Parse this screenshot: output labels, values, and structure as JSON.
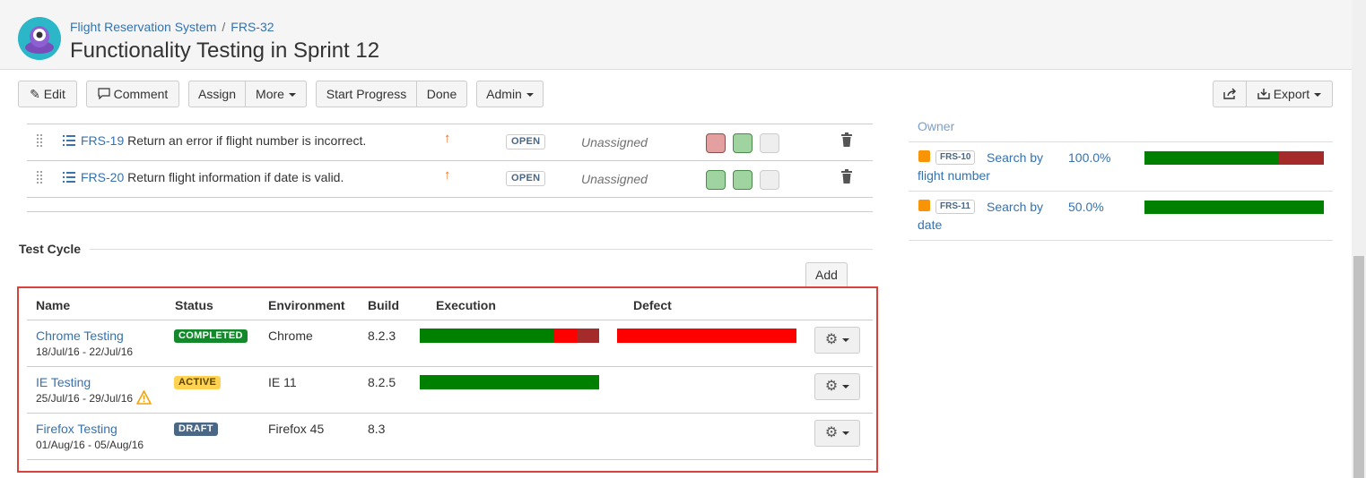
{
  "breadcrumb": {
    "project": "Flight Reservation System",
    "separator": "/",
    "issue_key": "FRS-32"
  },
  "page": {
    "title": "Functionality Testing in Sprint 12"
  },
  "toolbar": {
    "edit": "Edit",
    "comment": "Comment",
    "assign": "Assign",
    "more": "More",
    "start_progress": "Start Progress",
    "done": "Done",
    "admin": "Admin",
    "export": "Export"
  },
  "issues": [
    {
      "key": "FRS-19",
      "summary": "Return an error if flight number is incorrect.",
      "status": "OPEN",
      "assignee": "Unassigned",
      "results": [
        "red",
        "green",
        "grey"
      ]
    },
    {
      "key": "FRS-20",
      "summary": "Return flight information if date is valid.",
      "status": "OPEN",
      "assignee": "Unassigned",
      "results": [
        "green",
        "green",
        "grey"
      ]
    }
  ],
  "test_cycle": {
    "section_title": "Test Cycle",
    "add_label": "Add",
    "columns": {
      "name": "Name",
      "status": "Status",
      "environment": "Environment",
      "build": "Build",
      "execution": "Execution",
      "defect": "Defect"
    },
    "rows": [
      {
        "name": "Chrome Testing",
        "dates": "18/Jul/16 - 22/Jul/16",
        "status": "COMPLETED",
        "status_color": "#14892c",
        "environment": "Chrome",
        "build": "8.2.3",
        "execution": [
          {
            "fraction": 0.75,
            "color": "#008000"
          },
          {
            "fraction": 0.125,
            "color": "#ff0000"
          },
          {
            "fraction": 0.125,
            "color": "#a52a2a"
          }
        ],
        "defect": [
          {
            "fraction": 1.0,
            "color": "#ff0000"
          }
        ],
        "warning": false
      },
      {
        "name": "IE Testing",
        "dates": "25/Jul/16 - 29/Jul/16",
        "status": "ACTIVE",
        "status_color": "#ffd351",
        "environment": "IE 11",
        "build": "8.2.5",
        "execution": [
          {
            "fraction": 1.0,
            "color": "#008000"
          }
        ],
        "defect": [],
        "warning": true
      },
      {
        "name": "Firefox Testing",
        "dates": "01/Aug/16 - 05/Aug/16",
        "status": "DRAFT",
        "status_color": "#4a6785",
        "environment": "Firefox 45",
        "build": "8.3",
        "execution": [],
        "defect": [],
        "warning": false
      }
    ]
  },
  "requirements": {
    "owner_label": "Owner",
    "items": [
      {
        "key": "FRS-10",
        "title": "Search by flight number",
        "percent": "100.0%",
        "bar": [
          {
            "fraction": 0.75,
            "color": "#008000"
          },
          {
            "fraction": 0.25,
            "color": "#a52a2a"
          }
        ]
      },
      {
        "key": "FRS-11",
        "title": "Search by date",
        "percent": "50.0%",
        "bar": [
          {
            "fraction": 1.0,
            "color": "#008000"
          }
        ]
      }
    ]
  }
}
